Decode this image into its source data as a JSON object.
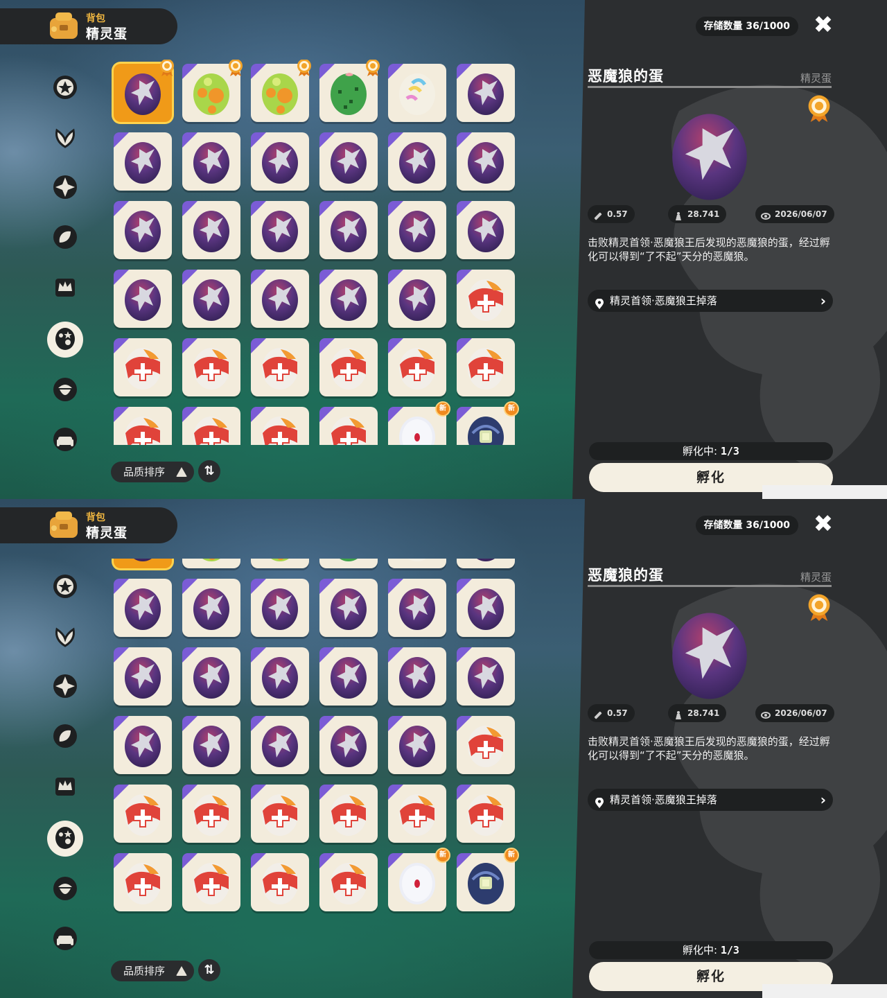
{
  "header": {
    "subtitle": "背包",
    "title": "精灵蛋"
  },
  "sidebar": {
    "items": [
      {
        "icon": "star-badge-icon",
        "active": false
      },
      {
        "icon": "leaf-icon",
        "active": false
      },
      {
        "icon": "sparkle-star-icon",
        "active": false
      },
      {
        "icon": "leaves-icon",
        "active": false
      },
      {
        "icon": "crown-scroll-icon",
        "active": false
      },
      {
        "icon": "egg-icon",
        "active": true
      },
      {
        "icon": "acorn-icon",
        "active": false
      },
      {
        "icon": "sofa-icon",
        "active": false
      }
    ]
  },
  "grid": {
    "rows": [
      [
        "demon-wolf-sel",
        "green-spotted",
        "green-spotted",
        "cactus",
        "rainbow",
        "demon-wolf"
      ],
      [
        "demon-wolf",
        "demon-wolf",
        "demon-wolf",
        "demon-wolf",
        "demon-wolf",
        "demon-wolf"
      ],
      [
        "demon-wolf",
        "demon-wolf",
        "demon-wolf",
        "demon-wolf",
        "demon-wolf",
        "demon-wolf"
      ],
      [
        "demon-wolf",
        "demon-wolf",
        "demon-wolf",
        "demon-wolf",
        "demon-wolf",
        "red-cross"
      ],
      [
        "red-cross",
        "red-cross",
        "red-cross",
        "red-cross",
        "red-cross",
        "red-cross"
      ],
      [
        "red-cross",
        "red-cross",
        "red-cross",
        "red-cross",
        "white-red",
        "blue-robot"
      ]
    ],
    "badges": {
      "0-0": "medal",
      "0-1": "medal",
      "0-2": "medal",
      "0-3": "medal",
      "5-4": "new",
      "5-5": "new"
    },
    "new_label": "新"
  },
  "sort": {
    "label": "品质排序"
  },
  "panel": {
    "storage": "存储数量 36/1000",
    "close": "✖",
    "title": "恶魔狼的蛋",
    "category": "精灵蛋",
    "stats": {
      "height": "0.57",
      "weight": "28.741",
      "date": "2026/06/07"
    },
    "description": "击败精灵首领·恶魔狼王后发现的恶魔狼的蛋，经过孵化可以得到“了不起”天分的恶魔狼。",
    "source": "精灵首领·恶魔狼王掉落",
    "hatching_label": "孵化中:",
    "hatching_value": "1/3",
    "hatch_button": "孵化"
  },
  "colors": {
    "selected": "#f09a18",
    "panel": "#2c2e30",
    "purple_corner": "#7b5cd6"
  }
}
